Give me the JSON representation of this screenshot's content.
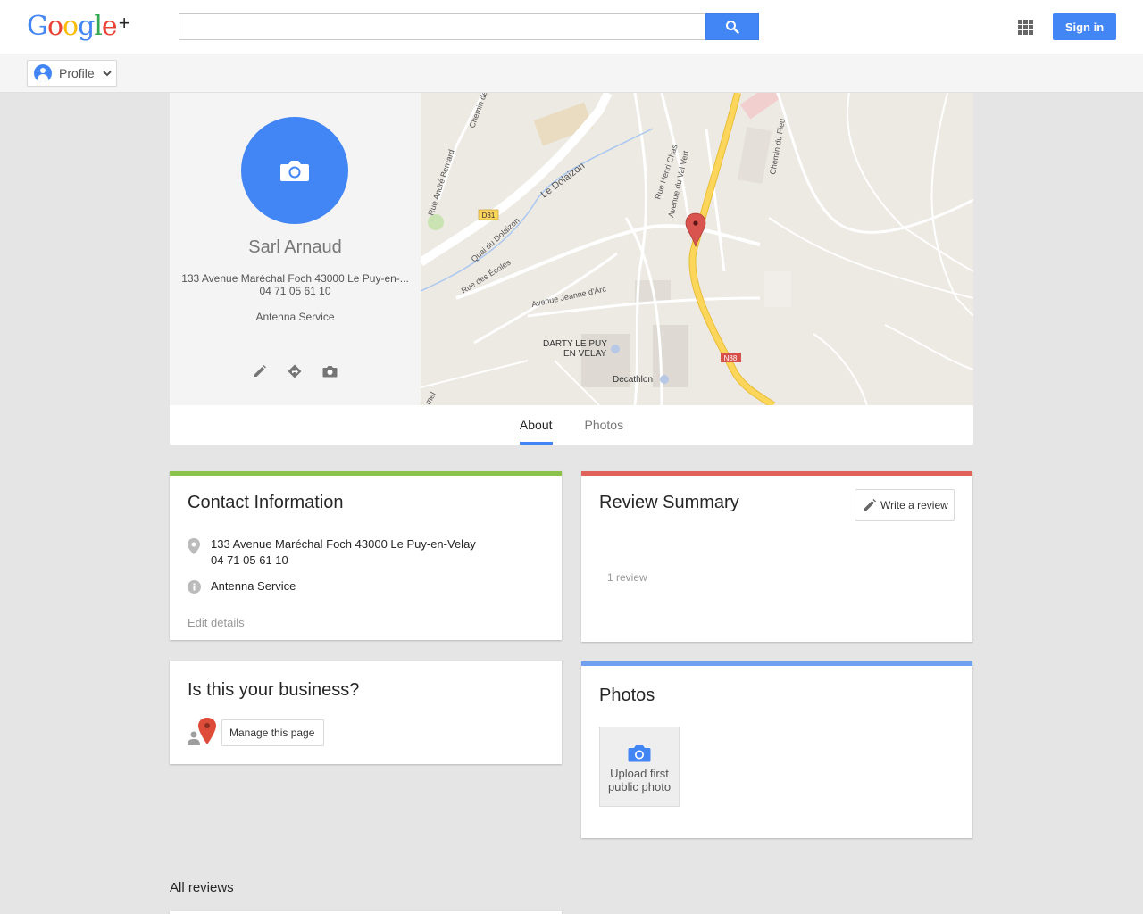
{
  "header": {
    "logo_text": "Google",
    "logo_plus": "+",
    "search_placeholder": "",
    "signin_label": "Sign in"
  },
  "subbar": {
    "profile_label": "Profile"
  },
  "business": {
    "name": "Sarl Arnaud",
    "address_short": "133 Avenue Maréchal Foch 43000 Le Puy-en-...",
    "phone": "04 71 05 61 10",
    "category": "Antenna Service"
  },
  "map": {
    "labels": [
      "Chemin de la Se",
      "Rue André Bernard",
      "Le Dolaizon",
      "Quai du Dolaizon",
      "Rue des Écoles",
      "Avenue Jeanne d'Arc",
      "Rue Henri Chas",
      "Avenue du Val Vert",
      "Chemin du Fieu",
      "DARTY LE PUY",
      "EN VELAY",
      "Decathlon",
      "mel"
    ],
    "road_badges": [
      "D31",
      "N88"
    ]
  },
  "tabs": [
    {
      "label": "About",
      "active": true
    },
    {
      "label": "Photos",
      "active": false
    }
  ],
  "contact": {
    "title": "Contact Information",
    "address": "133 Avenue Maréchal Foch 43000 Le Puy-en-Velay",
    "phone": "04 71 05 61 10",
    "category": "Antenna Service",
    "edit_label": "Edit details",
    "accent": "#8bc34a"
  },
  "review_summary": {
    "title": "Review Summary",
    "write_label": "Write a review",
    "count_label": "1 review",
    "accent": "#e0625a"
  },
  "ownership": {
    "title": "Is this your business?",
    "manage_label": "Manage this page"
  },
  "photos": {
    "title": "Photos",
    "upload_line1": "Upload first",
    "upload_line2": "public photo",
    "accent": "#6fa0f0"
  },
  "all_reviews_label": "All reviews",
  "colors": {
    "brand_blue": "#4285f4",
    "page_bg": "#e5e5e5"
  }
}
